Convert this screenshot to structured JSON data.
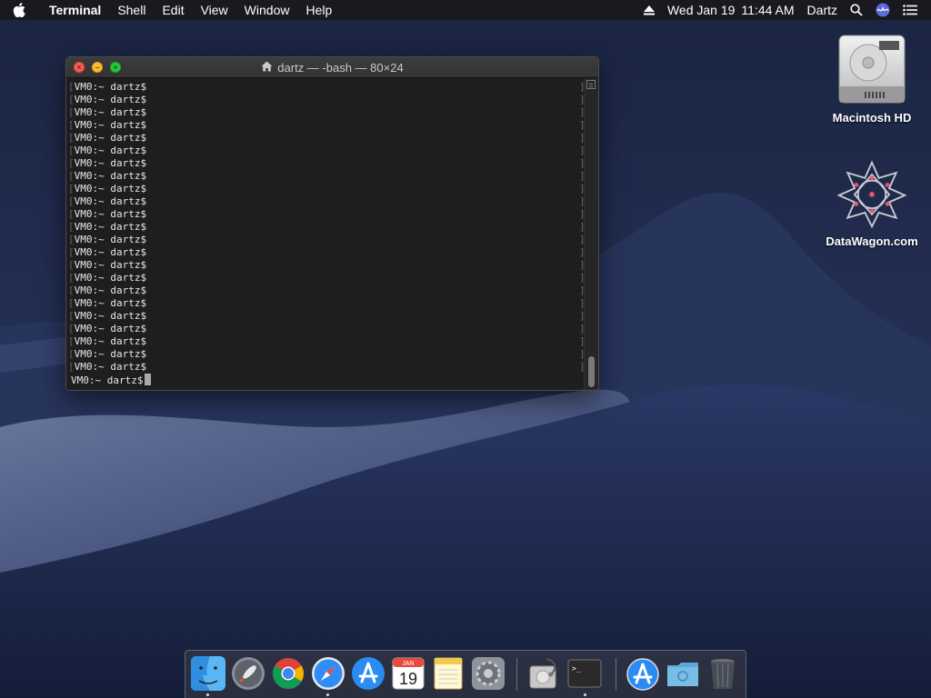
{
  "menubar": {
    "app_name": "Terminal",
    "menus": [
      "Shell",
      "Edit",
      "View",
      "Window",
      "Help"
    ],
    "date": "Wed Jan 19",
    "time": "11:44 AM",
    "user": "Dartz"
  },
  "terminal": {
    "title": "dartz — -bash — 80×24",
    "prompt": "VM0:~ dartz$",
    "history_lines": 23
  },
  "desktop_icons": [
    {
      "label": "Macintosh HD",
      "icon": "hard-drive-icon"
    },
    {
      "label": "DataWagon.com",
      "icon": "datawagon-logo-icon"
    }
  ],
  "dock": {
    "items": [
      {
        "name": "finder",
        "icon": "finder-icon",
        "running": true
      },
      {
        "name": "launchpad",
        "icon": "rocket-icon",
        "running": false
      },
      {
        "name": "chrome",
        "icon": "chrome-icon",
        "running": false
      },
      {
        "name": "safari",
        "icon": "safari-compass-icon",
        "running": true
      },
      {
        "name": "app-store",
        "icon": "app-store-icon",
        "running": false
      },
      {
        "name": "calendar",
        "icon": "calendar-icon",
        "running": false,
        "month": "JAN",
        "day": "19"
      },
      {
        "name": "notes",
        "icon": "notes-icon",
        "running": false
      },
      {
        "name": "system-preferences",
        "icon": "gear-icon",
        "running": false
      },
      {
        "name": "disk-utility",
        "icon": "disk-utility-icon",
        "running": false
      },
      {
        "name": "terminal",
        "icon": "terminal-icon",
        "running": true
      },
      {
        "name": "app-store-download",
        "icon": "app-store-icon",
        "running": false
      },
      {
        "name": "downloads",
        "icon": "folder-icon",
        "running": false
      },
      {
        "name": "trash",
        "icon": "trash-icon",
        "running": false
      }
    ]
  },
  "colors": {
    "close": "#fd5c57",
    "minimize": "#fdbc2e",
    "maximize": "#27c840",
    "terminal_bg": "#1e1e1e"
  }
}
